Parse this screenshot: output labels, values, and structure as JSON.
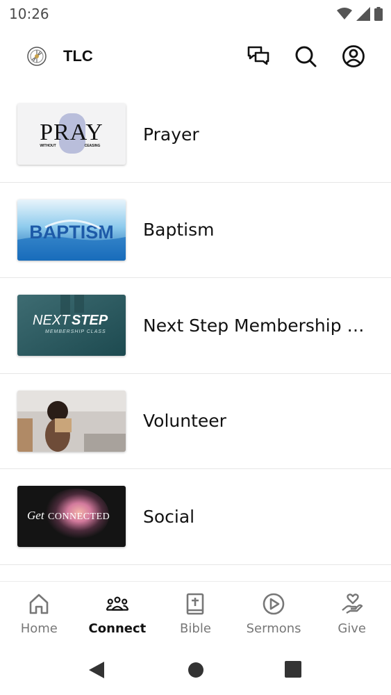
{
  "status_bar": {
    "time": "10:26"
  },
  "header": {
    "title": "TLC"
  },
  "items": [
    {
      "label": "Prayer",
      "thumb_main": "PRAY",
      "thumb_sub_left": "WITHOUT",
      "thumb_sub_right": "CEASING"
    },
    {
      "label": "Baptism",
      "thumb_main": "BAPTISM"
    },
    {
      "label": "Next Step Membership Class",
      "thumb_main_a": "NEXT",
      "thumb_main_b": "STEP",
      "thumb_sub": "MEMBERSHIP CLASS"
    },
    {
      "label": "Volunteer"
    },
    {
      "label": "Social",
      "thumb_main_a": "Get",
      "thumb_main_b": "CONNECTED"
    }
  ],
  "bottom_nav": [
    {
      "label": "Home",
      "icon": "home-icon"
    },
    {
      "label": "Connect",
      "icon": "people-icon",
      "active": true
    },
    {
      "label": "Bible",
      "icon": "bible-icon"
    },
    {
      "label": "Sermons",
      "icon": "play-circle-icon"
    },
    {
      "label": "Give",
      "icon": "hand-heart-icon"
    }
  ],
  "colors": {
    "active": "#111111",
    "inactive": "#777777",
    "divider": "#e6e6e6"
  }
}
